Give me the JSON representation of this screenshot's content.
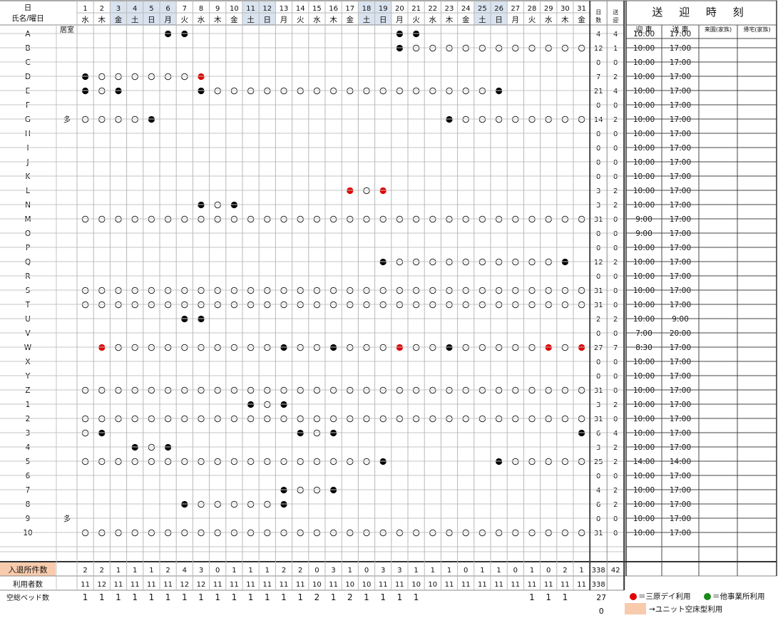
{
  "header": {
    "corner_day": "日",
    "corner_name": "氏名/曜日",
    "room_label": "居室",
    "days_label_top": "日",
    "days_label_bottom": "数",
    "send_label_top": "送",
    "send_label_bottom": "迎",
    "title": "送 迎 時 刻",
    "col_pickup": "迎 車",
    "col_dropoff": "送 車",
    "col_visit": "来園(家族)",
    "col_return": "帰宅(家族)"
  },
  "days": [
    {
      "d": "1",
      "w": "水",
      "hl": false
    },
    {
      "d": "2",
      "w": "木",
      "hl": false
    },
    {
      "d": "3",
      "w": "金",
      "hl": true
    },
    {
      "d": "4",
      "w": "土",
      "hl": true
    },
    {
      "d": "5",
      "w": "日",
      "hl": true
    },
    {
      "d": "6",
      "w": "月",
      "hl": true
    },
    {
      "d": "7",
      "w": "火",
      "hl": false
    },
    {
      "d": "8",
      "w": "水",
      "hl": false
    },
    {
      "d": "9",
      "w": "木",
      "hl": false
    },
    {
      "d": "10",
      "w": "金",
      "hl": false
    },
    {
      "d": "11",
      "w": "土",
      "hl": true
    },
    {
      "d": "12",
      "w": "日",
      "hl": true
    },
    {
      "d": "13",
      "w": "月",
      "hl": false
    },
    {
      "d": "14",
      "w": "火",
      "hl": false
    },
    {
      "d": "15",
      "w": "水",
      "hl": false
    },
    {
      "d": "16",
      "w": "木",
      "hl": false
    },
    {
      "d": "17",
      "w": "金",
      "hl": false
    },
    {
      "d": "18",
      "w": "土",
      "hl": true
    },
    {
      "d": "19",
      "w": "日",
      "hl": true
    },
    {
      "d": "20",
      "w": "月",
      "hl": false
    },
    {
      "d": "21",
      "w": "火",
      "hl": false
    },
    {
      "d": "22",
      "w": "水",
      "hl": false
    },
    {
      "d": "23",
      "w": "木",
      "hl": false
    },
    {
      "d": "24",
      "w": "金",
      "hl": false
    },
    {
      "d": "25",
      "w": "土",
      "hl": true
    },
    {
      "d": "26",
      "w": "日",
      "hl": true
    },
    {
      "d": "27",
      "w": "月",
      "hl": false
    },
    {
      "d": "28",
      "w": "火",
      "hl": false
    },
    {
      "d": "29",
      "w": "水",
      "hl": false
    },
    {
      "d": "30",
      "w": "木",
      "hl": false
    },
    {
      "d": "31",
      "w": "金",
      "hl": false
    }
  ],
  "symbols_key": "marks string: one char per day 1-31; '.'=blank, 'o'=○, 'b'=● black, 'r'=● red",
  "residents": [
    {
      "name": "A",
      "room": "",
      "marks": ".....bb............bb..........",
      "days": "4",
      "send": "4",
      "pickup": "10:00",
      "dropoff": "17:00"
    },
    {
      "name": "B",
      "room": "",
      "marks": "...................booooooooooo",
      "days": "12",
      "send": "1",
      "pickup": "10:00",
      "dropoff": "17:00"
    },
    {
      "name": "C",
      "room": "",
      "marks": "...............................",
      "days": "0",
      "send": "0",
      "pickup": "10:00",
      "dropoff": "17:00"
    },
    {
      "name": "D",
      "room": "",
      "marks": "boooooor.......................",
      "days": "7",
      "send": "2",
      "pickup": "10:00",
      "dropoff": "17:00"
    },
    {
      "name": "E",
      "room": "",
      "marks": "bob....booooooooooooooooob......",
      "days": "21",
      "send": "4",
      "pickup": "10:00",
      "dropoff": "17:00"
    },
    {
      "name": "F",
      "room": "",
      "marks": "...............................",
      "days": "0",
      "send": "0",
      "pickup": "10:00",
      "dropoff": "17:00"
    },
    {
      "name": "G",
      "room": "多",
      "marks": "oooob.................boooooooo",
      "days": "14",
      "send": "2",
      "pickup": "10:00",
      "dropoff": "17:00"
    },
    {
      "name": "H",
      "room": "",
      "marks": "...............................",
      "days": "0",
      "send": "0",
      "pickup": "10:00",
      "dropoff": "17:00"
    },
    {
      "name": "I",
      "room": "",
      "marks": "...............................",
      "days": "0",
      "send": "0",
      "pickup": "10:00",
      "dropoff": "17:00"
    },
    {
      "name": "J",
      "room": "",
      "marks": "...............................",
      "days": "0",
      "send": "0",
      "pickup": "10:00",
      "dropoff": "17:00"
    },
    {
      "name": "K",
      "room": "",
      "marks": "...............................",
      "days": "0",
      "send": "0",
      "pickup": "10:00",
      "dropoff": "17:00"
    },
    {
      "name": "L",
      "room": "",
      "marks": "................ror............",
      "days": "3",
      "send": "2",
      "pickup": "10:00",
      "dropoff": "17:00"
    },
    {
      "name": "N",
      "room": "",
      "marks": ".......bob.....................",
      "days": "3",
      "send": "2",
      "pickup": "10:00",
      "dropoff": "17:00"
    },
    {
      "name": "M",
      "room": "",
      "marks": "ooooooooooooooooooooooooooooooo",
      "days": "31",
      "send": "0",
      "pickup": "9:00",
      "dropoff": "17:00"
    },
    {
      "name": "O",
      "room": "",
      "marks": "...............................",
      "days": "0",
      "send": "0",
      "pickup": "9:00",
      "dropoff": "17:00"
    },
    {
      "name": "P",
      "room": "",
      "marks": "...............................",
      "days": "0",
      "send": "0",
      "pickup": "10:00",
      "dropoff": "17:00"
    },
    {
      "name": "Q",
      "room": "",
      "marks": "..................boooooooooob.",
      "days": "12",
      "send": "2",
      "pickup": "10:00",
      "dropoff": "17:00"
    },
    {
      "name": "R",
      "room": "",
      "marks": "...............................",
      "days": "0",
      "send": "0",
      "pickup": "10:00",
      "dropoff": "17:00"
    },
    {
      "name": "S",
      "room": "",
      "marks": "ooooooooooooooooooooooooooooooo",
      "days": "31",
      "send": "0",
      "pickup": "10:00",
      "dropoff": "17:00"
    },
    {
      "name": "T",
      "room": "",
      "marks": "ooooooooooooooooooooooooooooooo",
      "days": "31",
      "send": "0",
      "pickup": "10:00",
      "dropoff": "17:00"
    },
    {
      "name": "U",
      "room": "",
      "marks": "......bb.......................",
      "days": "2",
      "send": "2",
      "pickup": "10:00",
      "dropoff": "9:00"
    },
    {
      "name": "V",
      "room": "",
      "marks": "...............................",
      "days": "0",
      "send": "0",
      "pickup": "7:00",
      "dropoff": "20:00"
    },
    {
      "name": "W",
      "room": "",
      "marks": ".roooooooooobooboooroobooooororo",
      "days": "27",
      "send": "7",
      "pickup": "8:30",
      "dropoff": "17:00"
    },
    {
      "name": "X",
      "room": "",
      "marks": "...............................",
      "days": "0",
      "send": "0",
      "pickup": "10:00",
      "dropoff": "17:00"
    },
    {
      "name": "Y",
      "room": "",
      "marks": "...............................",
      "days": "0",
      "send": "0",
      "pickup": "10:00",
      "dropoff": "17:00"
    },
    {
      "name": "Z",
      "room": "",
      "marks": "ooooooooooooooooooooooooooooooo",
      "days": "31",
      "send": "0",
      "pickup": "10:00",
      "dropoff": "17:00"
    },
    {
      "name": "1",
      "room": "",
      "marks": "..........bob..................",
      "days": "3",
      "send": "2",
      "pickup": "10:00",
      "dropoff": "17:00"
    },
    {
      "name": "2",
      "room": "",
      "marks": "ooooooooooooooooooooooooooooooo",
      "days": "31",
      "send": "0",
      "pickup": "10:00",
      "dropoff": "17:00"
    },
    {
      "name": "3",
      "room": "",
      "marks": "ob...........bob..............b",
      "days": "6",
      "send": "4",
      "pickup": "10:00",
      "dropoff": "17:00"
    },
    {
      "name": "4",
      "room": "",
      "marks": "...bob.........................",
      "days": "3",
      "send": "2",
      "pickup": "10:00",
      "dropoff": "17:00"
    },
    {
      "name": "5",
      "room": "",
      "marks": "oooooooooooooooooob......booooo",
      "days": "25",
      "send": "2",
      "pickup": "14:00",
      "dropoff": "14:00"
    },
    {
      "name": "6",
      "room": "",
      "marks": "...............................",
      "days": "0",
      "send": "0",
      "pickup": "10:00",
      "dropoff": "17:00"
    },
    {
      "name": "7",
      "room": "",
      "marks": "............boob...............",
      "days": "4",
      "send": "2",
      "pickup": "10:00",
      "dropoff": "17:00"
    },
    {
      "name": "8",
      "room": "",
      "marks": "......booooob..................",
      "days": "6",
      "send": "2",
      "pickup": "10:00",
      "dropoff": "17:00"
    },
    {
      "name": "9",
      "room": "多",
      "marks": "...............................",
      "days": "0",
      "send": "0",
      "pickup": "10:00",
      "dropoff": "17:00"
    },
    {
      "name": "10",
      "room": "",
      "marks": "ooooooooooooooooooooooooooooooo",
      "days": "31",
      "send": "0",
      "pickup": "10:00",
      "dropoff": "17:00"
    }
  ],
  "footer": {
    "moves_label": "入退所件数",
    "moves": [
      "2",
      "2",
      "1",
      "1",
      "1",
      "2",
      "4",
      "3",
      "0",
      "1",
      "1",
      "1",
      "2",
      "2",
      "0",
      "3",
      "1",
      "0",
      "3",
      "3",
      "1",
      "1",
      "1",
      "0",
      "1",
      "1",
      "0",
      "1",
      "0",
      "2",
      "1"
    ],
    "moves_total": "338",
    "moves_send_total": "42",
    "users_label": "利用者数",
    "users": [
      "11",
      "12",
      "11",
      "11",
      "11",
      "11",
      "12",
      "12",
      "11",
      "11",
      "11",
      "11",
      "11",
      "11",
      "10",
      "11",
      "10",
      "10",
      "11",
      "11",
      "10",
      "10",
      "11",
      "11",
      "11",
      "11",
      "11",
      "11",
      "11",
      "11",
      "11"
    ],
    "users_total": "338",
    "beds_label": "空総ベッド数",
    "beds": [
      "1",
      "1",
      "1",
      "1",
      "1",
      "1",
      "1",
      "1",
      "1",
      "1",
      "1",
      "1",
      "1",
      "1",
      "2",
      "1",
      "2",
      "1",
      "1",
      "1",
      "1",
      "",
      "",
      "",
      "",
      "",
      "",
      "1",
      "1",
      "1",
      ""
    ],
    "beds_total": "27",
    "extra_total": "0"
  },
  "legend": {
    "red_text": "＝三原デイ利用",
    "green_text": "＝他事業所利用",
    "unit_text": "→ユニット空床型利用",
    "red_color": "#e00000",
    "green_color": "#1a8a1a",
    "orange_color": "#f8cbad"
  }
}
